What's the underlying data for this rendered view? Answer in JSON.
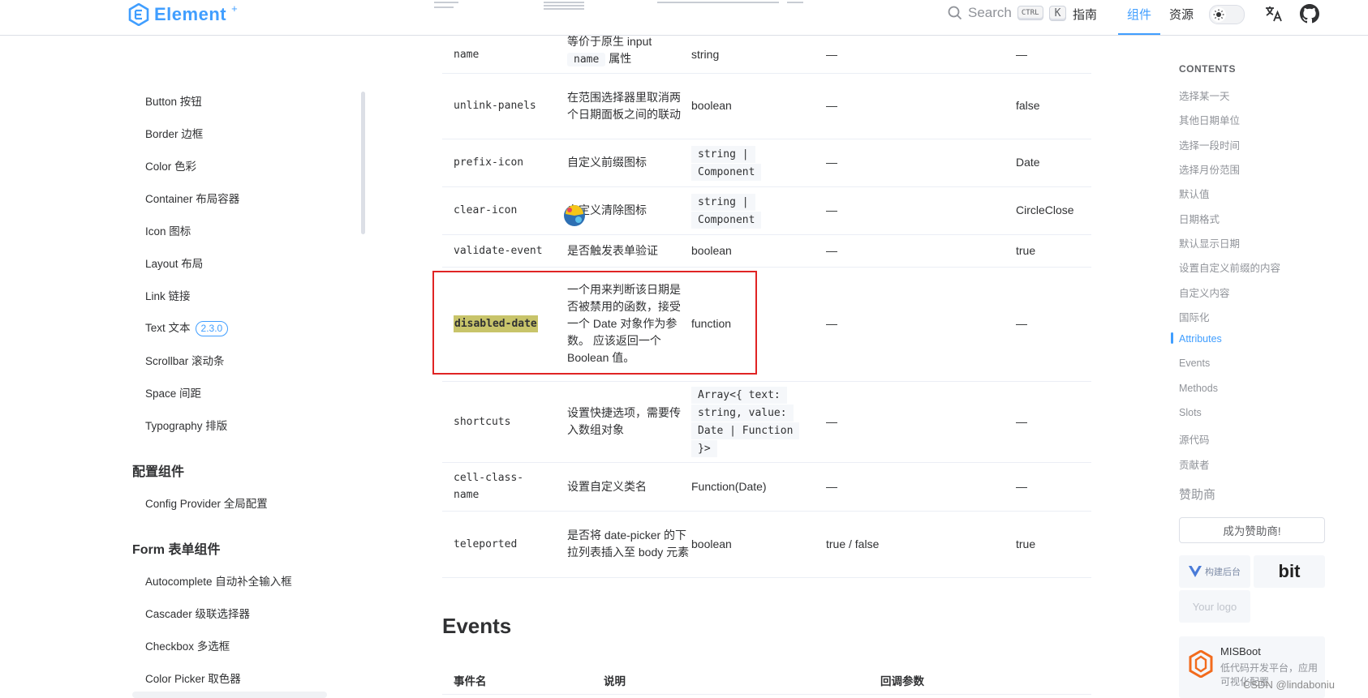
{
  "header": {
    "logo_text": "Element",
    "logo_sup": "+",
    "search_placeholder": "Search",
    "kbd_ctrl": "CTRL",
    "kbd_k": "K",
    "nav": [
      "指南",
      "组件",
      "资源"
    ],
    "active_nav": "组件"
  },
  "sidebar": {
    "items_basic": [
      {
        "label": "Button 按钮"
      },
      {
        "label": "Border 边框"
      },
      {
        "label": "Color 色彩"
      },
      {
        "label": "Container 布局容器"
      },
      {
        "label": "Icon 图标"
      },
      {
        "label": "Layout 布局"
      },
      {
        "label": "Link 链接"
      },
      {
        "label": "Text 文本",
        "badge": "2.3.0"
      },
      {
        "label": "Scrollbar 滚动条"
      },
      {
        "label": "Space 间距"
      },
      {
        "label": "Typography 排版"
      }
    ],
    "heading_config": "配置组件",
    "items_config": [
      {
        "label": "Config Provider 全局配置"
      }
    ],
    "heading_form": "Form 表单组件",
    "items_form": [
      {
        "label": "Autocomplete 自动补全输入框"
      },
      {
        "label": "Cascader 级联选择器"
      },
      {
        "label": "Checkbox 多选框"
      },
      {
        "label": "Color Picker 取色器"
      }
    ]
  },
  "attributes": {
    "rows": [
      {
        "name": "name",
        "desc": [
          "等价于原生 input",
          "name",
          "属性"
        ],
        "type": "string",
        "accepted": "—",
        "default": "—"
      },
      {
        "name": "unlink-panels",
        "desc": "在范围选择器里取消两个日期面板之间的联动",
        "type": "boolean",
        "accepted": "—",
        "default": "false"
      },
      {
        "name": "prefix-icon",
        "desc": "自定义前缀图标",
        "type_lines": [
          "string |",
          "Component"
        ],
        "accepted": "—",
        "default": "Date"
      },
      {
        "name": "clear-icon",
        "desc": "自定义清除图标",
        "type_lines": [
          "string |",
          "Component"
        ],
        "accepted": "—",
        "default": "CircleClose"
      },
      {
        "name": "validate-event",
        "desc": "是否触发表单验证",
        "type": "boolean",
        "accepted": "—",
        "default": "true"
      },
      {
        "name": "disabled-date",
        "desc": "一个用来判断该日期是否被禁用的函数，接受一个 Date 对象作为参数。 应该返回一个 Boolean 值。",
        "type": "function",
        "accepted": "—",
        "default": "—"
      },
      {
        "name": "shortcuts",
        "desc": "设置快捷选项，需要传入数组对象",
        "type_lines": [
          "Array<{ text:",
          "string, value:",
          "Date | Function",
          "}>"
        ],
        "accepted": "—",
        "default": "—"
      },
      {
        "name": "cell-class-name",
        "desc": "设置自定义类名",
        "type": "Function(Date)",
        "accepted": "—",
        "default": "—"
      },
      {
        "name": "teleported",
        "desc": "是否将 date-picker 的下拉列表插入至 body 元素",
        "type": "boolean",
        "accepted": "true / false",
        "default": "true"
      }
    ]
  },
  "events": {
    "title": "Events",
    "columns": [
      "事件名",
      "说明",
      "回调参数"
    ]
  },
  "toc": {
    "title": "CONTENTS",
    "items": [
      "选择某一天",
      "其他日期单位",
      "选择一段时间",
      "选择月份范围",
      "默认值",
      "日期格式",
      "默认显示日期",
      "设置自定义前缀的内容",
      "自定义内容",
      "国际化",
      "Attributes",
      "Events",
      "Methods",
      "Slots",
      "源代码",
      "贡献者"
    ],
    "active": "Attributes",
    "sponsor_heading": "赞助商",
    "sponsor_button": "成为赞助商!",
    "sponsor1_text": "构建后台",
    "sponsor2_text": "bit",
    "sponsor3_text": "Your logo",
    "misboot_title": "MISBoot",
    "misboot_desc": "低代码开发平台，应用可视化配置",
    "watermark": "CSDN @lindaboniu"
  },
  "colors": {
    "accent": "#409eff",
    "highlight_box": "#e02424",
    "search_highlight": "#c8c46a"
  }
}
